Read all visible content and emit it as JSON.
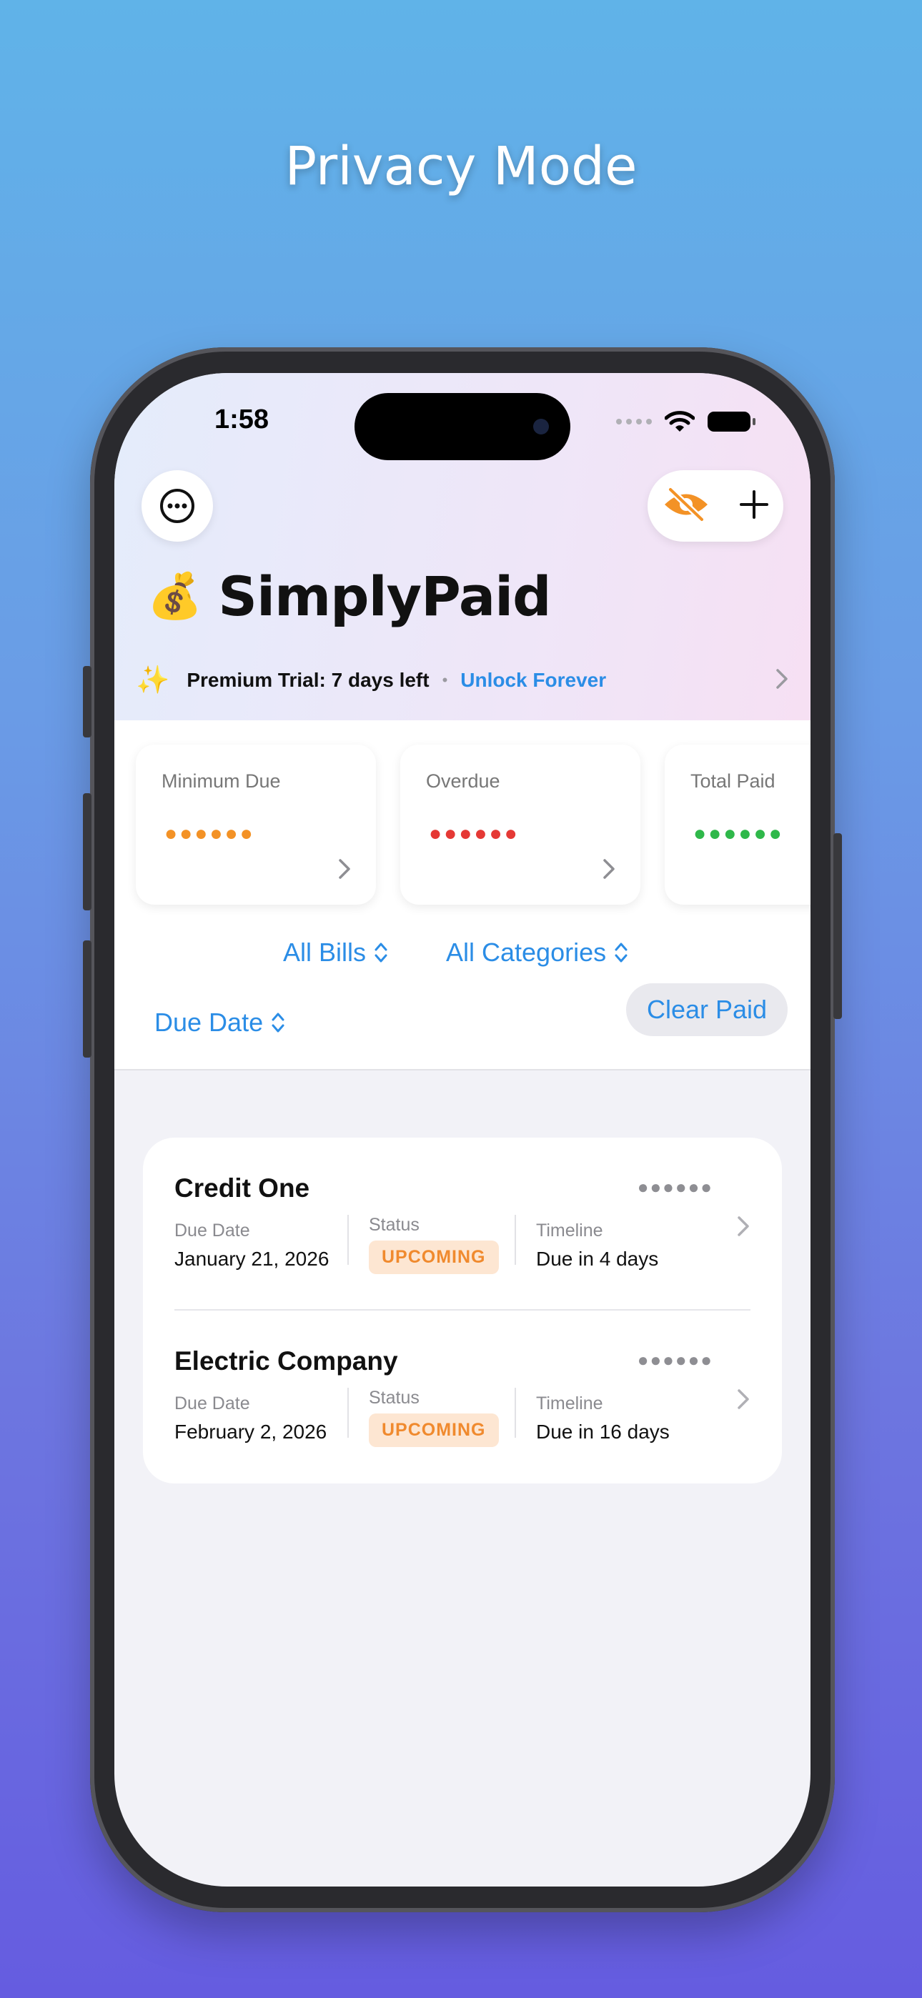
{
  "promo": {
    "headline": "Privacy Mode"
  },
  "status_bar": {
    "time": "1:58"
  },
  "app": {
    "emoji": "💰",
    "title": "SimplyPaid"
  },
  "trial": {
    "text": "Premium Trial: 7 days left",
    "separator": "•",
    "link": "Unlock Forever"
  },
  "summary_cards": [
    {
      "label": "Minimum Due",
      "masked_value": "●●●●●●",
      "color": "#f39226"
    },
    {
      "label": "Overdue",
      "masked_value": "●●●●●●",
      "color": "#e53935"
    },
    {
      "label": "Total Paid",
      "masked_value": "●●●●●●",
      "color": "#2fb84a"
    }
  ],
  "filters": {
    "bills": "All Bills",
    "categories": "All Categories",
    "sort": "Due Date",
    "clear": "Clear Paid"
  },
  "bills": [
    {
      "name": "Credit One",
      "masked_amount": "●●●●●●",
      "due_label": "Due Date",
      "due_value": "January 21, 2026",
      "status_label": "Status",
      "status_value": "UPCOMING",
      "timeline_label": "Timeline",
      "timeline_value": "Due in 4 days"
    },
    {
      "name": "Electric Company",
      "masked_amount": "●●●●●●",
      "due_label": "Due Date",
      "due_value": "February 2, 2026",
      "status_label": "Status",
      "status_value": "UPCOMING",
      "timeline_label": "Timeline",
      "timeline_value": "Due in 16 days"
    }
  ],
  "icons": {
    "more": "ellipsis-circle-icon",
    "privacy": "eye-slash-icon",
    "add": "plus-icon",
    "sparkles": "sparkles-icon",
    "chevron": "chevron-right-icon",
    "sort": "chevron-up-down-icon"
  },
  "colors": {
    "accent": "#2b8de6",
    "privacy_icon": "#f39226",
    "badge_bg": "#fde6d2",
    "badge_text": "#f08a2e"
  }
}
